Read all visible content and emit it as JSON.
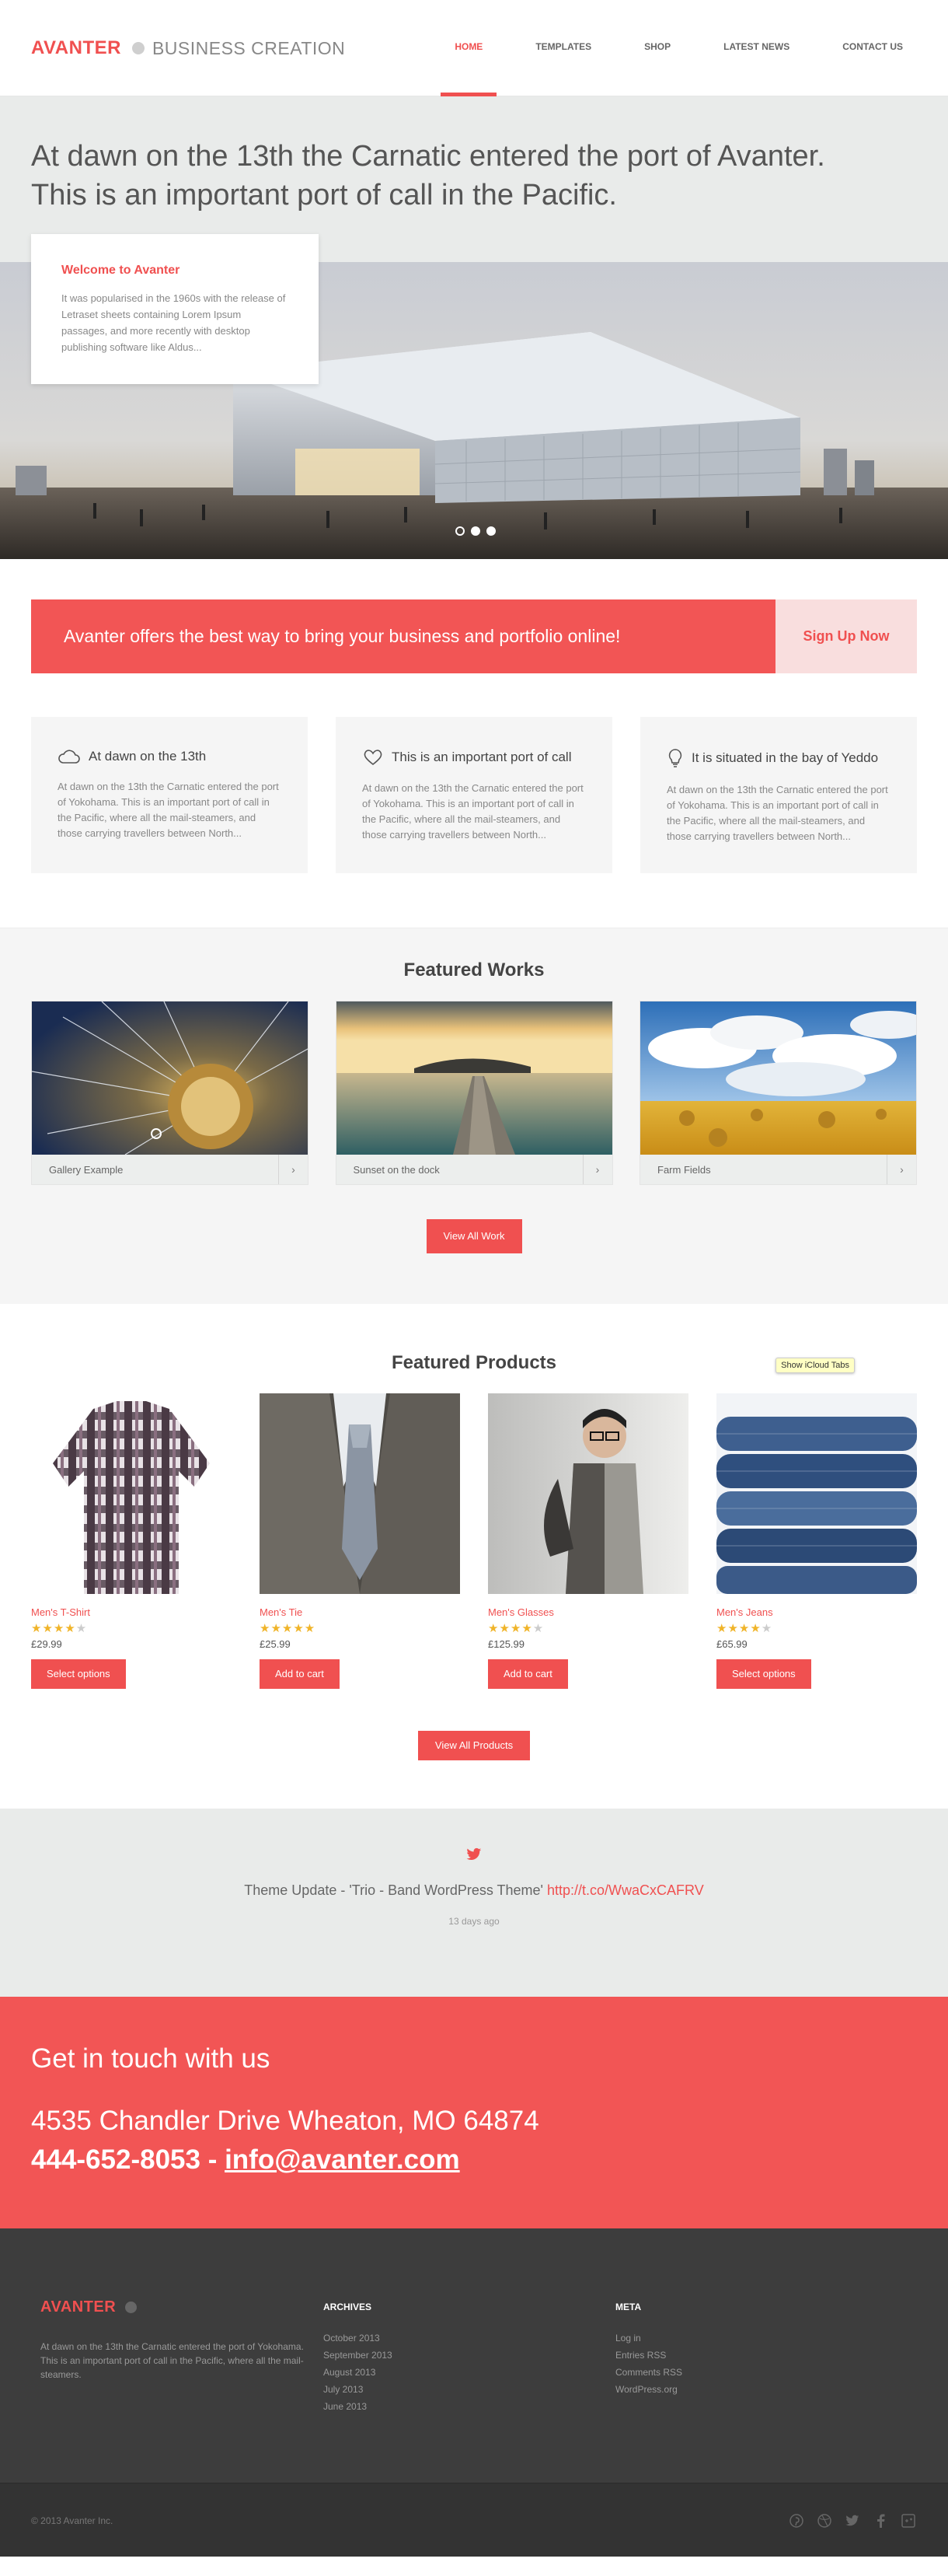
{
  "header": {
    "logo_main": "AVANTER",
    "logo_sub": "BUSINESS CREATION",
    "nav": [
      "HOME",
      "TEMPLATES",
      "SHOP",
      "LATEST NEWS",
      "CONTACT US"
    ]
  },
  "hero": {
    "title_line1": "At dawn on the 13th the Carnatic entered the port of Avanter.",
    "title_line2": "This is an important port of call in the Pacific.",
    "card_title": "Welcome to Avanter",
    "card_text": "It was popularised in the 1960s with the release of Letraset sheets containing Lorem Ipsum passages, and more recently with desktop publishing software like Aldus..."
  },
  "cta": {
    "text": "Avanter offers the best way to bring your business and portfolio online!",
    "button": "Sign Up Now"
  },
  "features": [
    {
      "icon": "cloud-icon",
      "title": "At dawn on the 13th",
      "text": "At dawn on the 13th the Carnatic entered the port of Yokohama.  This is an important port of call in the Pacific, where all the mail-steamers, and those carrying travellers between North..."
    },
    {
      "icon": "heart-icon",
      "title": "This is an important port of call",
      "text": "At dawn on the 13th the Carnatic entered the port of Yokohama.  This is an important port of call in the Pacific, where all the mail-steamers, and those carrying travellers between North..."
    },
    {
      "icon": "lightbulb-icon",
      "title": "It is situated in the bay of Yeddo",
      "text": "At dawn on the 13th the Carnatic entered the port of Yokohama.  This is an important port of call in the Pacific, where all the mail-steamers, and those carrying travellers between North..."
    }
  ],
  "works": {
    "title": "Featured Works",
    "items": [
      "Gallery Example",
      "Sunset on the dock",
      "Farm Fields"
    ],
    "arrow": "›",
    "button": "View All Work"
  },
  "products": {
    "title": "Featured Products",
    "tooltip": "Show iCloud Tabs",
    "items": [
      {
        "name": "Men's T-Shirt",
        "price": "£29.99",
        "rating": 4,
        "button": "Select options"
      },
      {
        "name": "Men's Tie",
        "price": "£25.99",
        "rating": 5,
        "button": "Add to cart"
      },
      {
        "name": "Men's Glasses",
        "price": "£125.99",
        "rating": 4,
        "button": "Add to cart"
      },
      {
        "name": "Men's Jeans",
        "price": "£65.99",
        "rating": 4,
        "button": "Select options"
      }
    ],
    "button": "View All Products"
  },
  "tweet": {
    "text": "Theme Update - 'Trio - Band WordPress Theme' ",
    "link": "http://t.co/WwaCxCAFRV",
    "time": "13 days ago"
  },
  "contact": {
    "heading": "Get in touch with us",
    "address": "4535 Chandler Drive Wheaton, MO 64874",
    "phone": "444-652-8053 - ",
    "email": "info@avanter.com"
  },
  "footer": {
    "logo": "AVANTER",
    "desc": "At dawn on the 13th the Carnatic entered the port of Yokohama. This is an important port of call in the Pacific, where all the mail-steamers.",
    "archives_title": "ARCHIVES",
    "archives": [
      "October 2013",
      "September 2013",
      "August 2013",
      "July 2013",
      "June 2013"
    ],
    "meta_title": "META",
    "meta": [
      "Log in",
      "Entries RSS",
      "Comments RSS",
      "WordPress.org"
    ],
    "copyright": "© 2013 Avanter Inc."
  },
  "colors": {
    "accent": "#f05050",
    "light_bg": "#e9ebea",
    "dark_bg": "#3d3d3d"
  }
}
